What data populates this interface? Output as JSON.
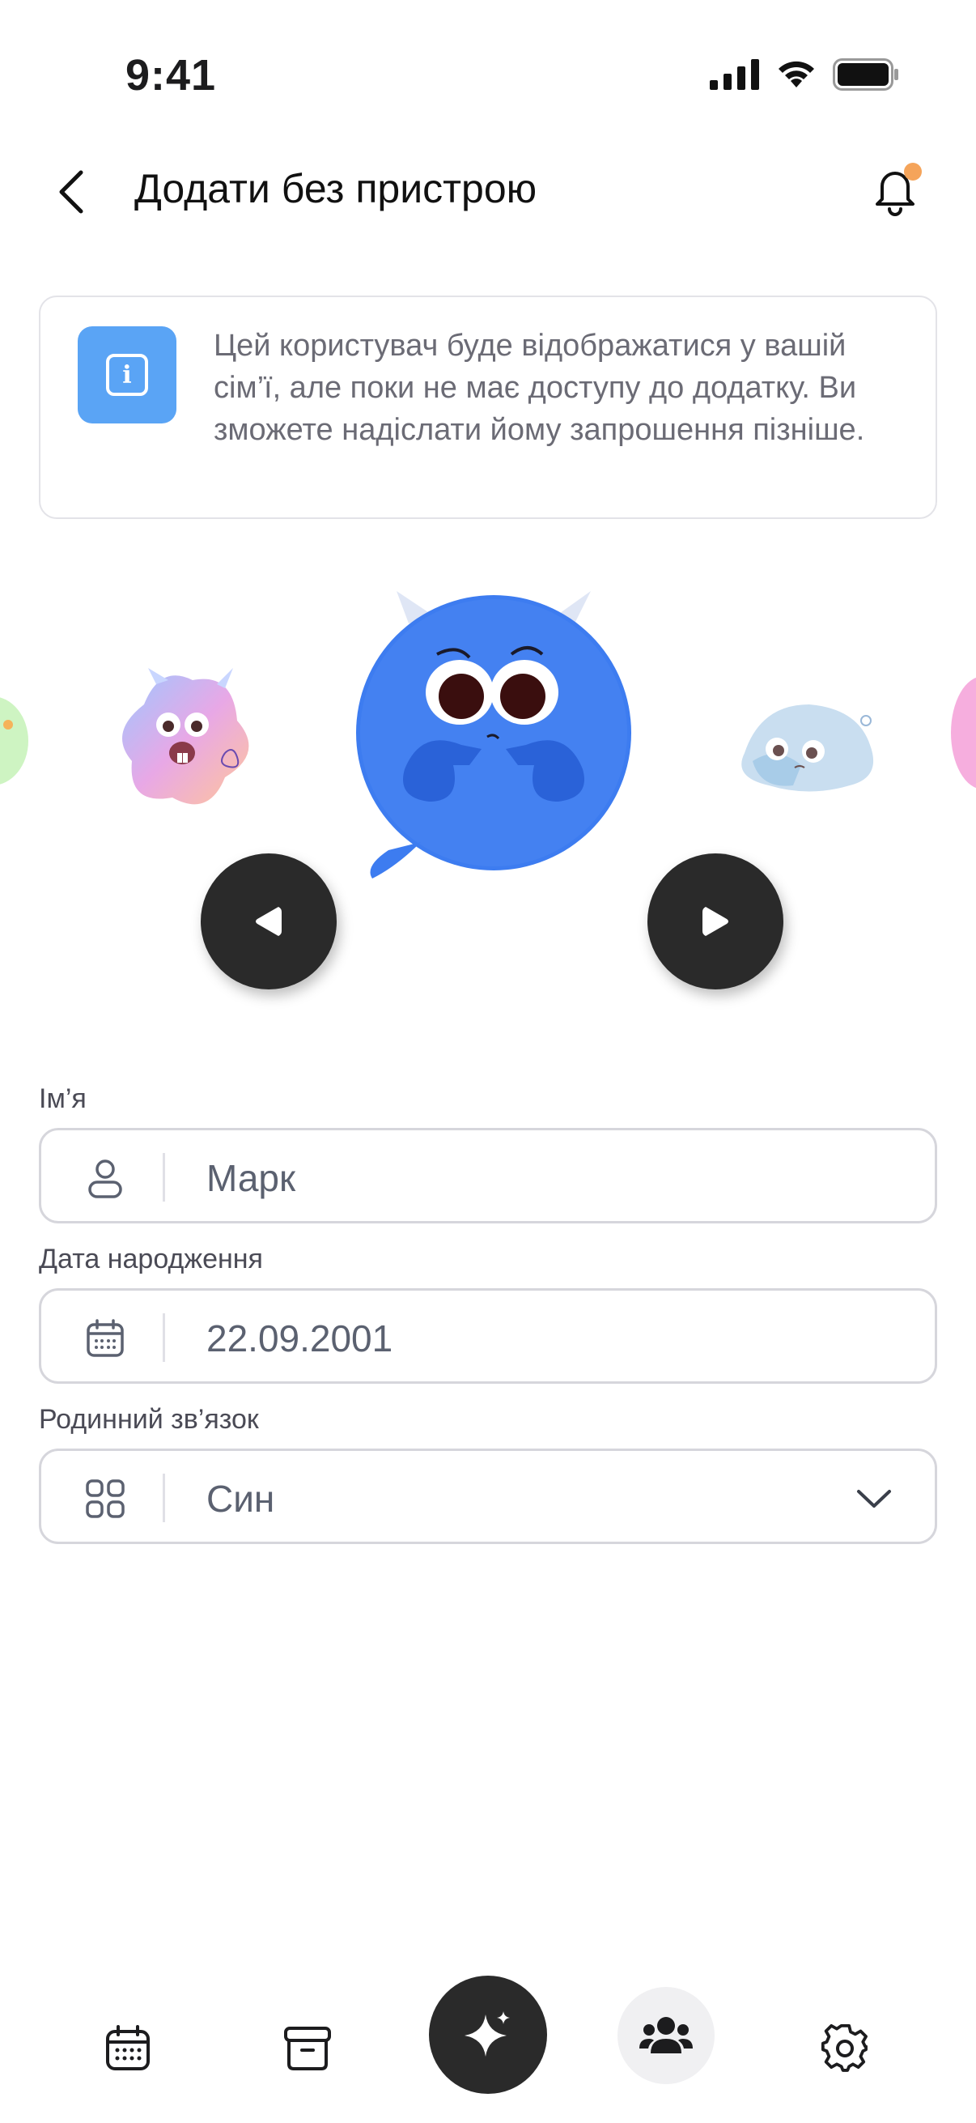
{
  "status_bar": {
    "time": "9:41"
  },
  "header": {
    "title": "Додати без пристрою"
  },
  "info": {
    "text": "Цей користувач буде відображатися у вашій сім’ї, але поки не має доступу до додатку. Ви зможете надіслати йому запрошення пізніше."
  },
  "form": {
    "name": {
      "label": "Ім’я",
      "value": "Марк",
      "icon": "user-icon"
    },
    "birthdate": {
      "label": "Дата народження",
      "value": "22.09.2001",
      "icon": "calendar-icon"
    },
    "relation": {
      "label": "Родинний зв’язок",
      "value": "Син",
      "icon": "grid-icon"
    }
  },
  "tabbar": {
    "items": [
      "calendar-icon",
      "archive-icon",
      "sparkle-icon",
      "family-icon",
      "settings-icon"
    ],
    "active": "family-icon"
  },
  "colors": {
    "accent": "#5aa4f5",
    "dark": "#2a2a2a",
    "notification_dot": "#f5a45a",
    "character_blue": "#3d7cf0"
  }
}
